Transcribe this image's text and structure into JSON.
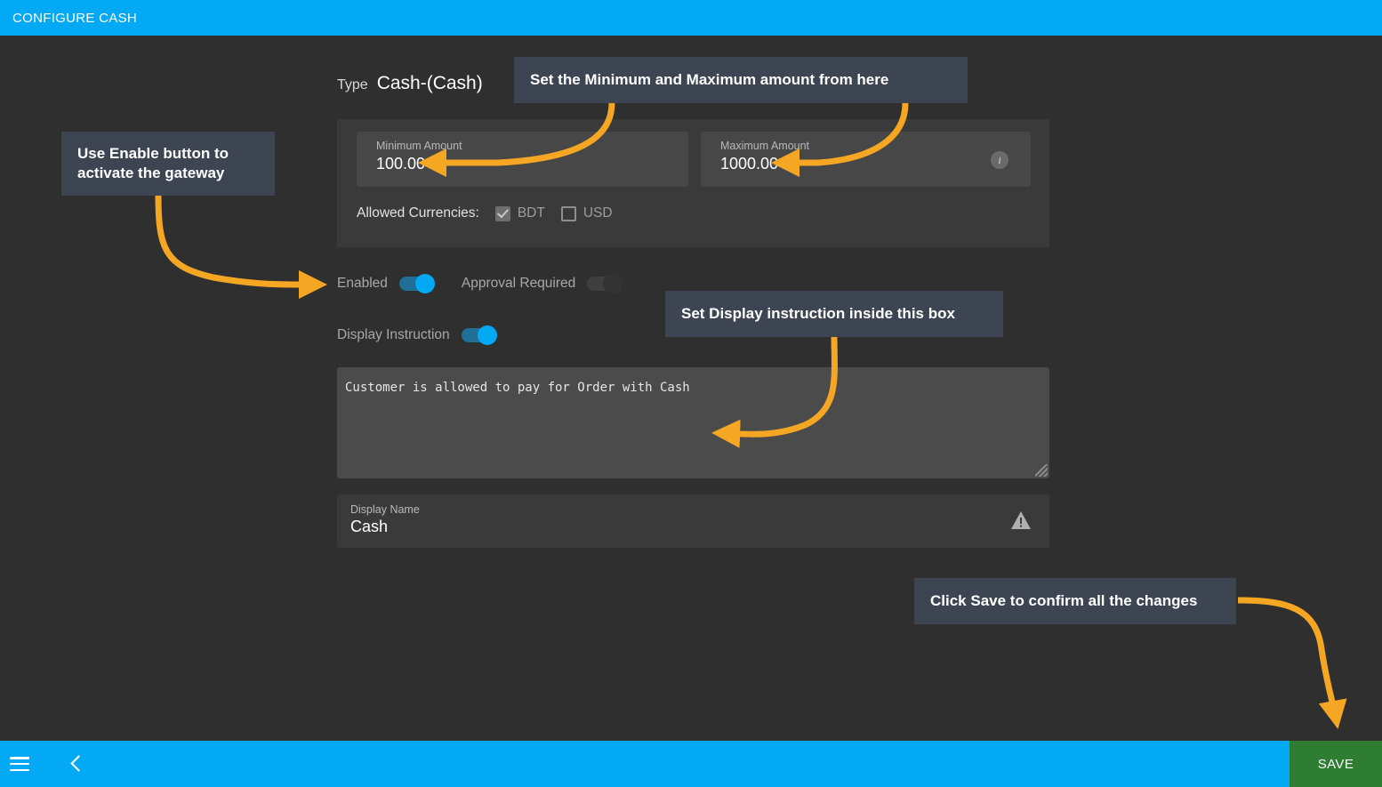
{
  "titlebar": {
    "title": "CONFIGURE CASH"
  },
  "type_row": {
    "label": "Type",
    "value": "Cash-(Cash)"
  },
  "amount_panel": {
    "minimum": {
      "label": "Minimum Amount",
      "value": "100.00"
    },
    "maximum": {
      "label": "Maximum Amount",
      "value": "1000.00"
    },
    "info_icon": "i",
    "currencies": {
      "label": "Allowed Currencies:",
      "options": [
        {
          "code": "BDT",
          "checked": true
        },
        {
          "code": "USD",
          "checked": false
        }
      ]
    }
  },
  "toggles": {
    "enabled": {
      "label": "Enabled",
      "state": "on"
    },
    "approval_required": {
      "label": "Approval Required",
      "state": "off"
    },
    "display_instruction": {
      "label": "Display Instruction",
      "state": "on"
    }
  },
  "instruction": {
    "text": "Customer is allowed to pay for Order with Cash"
  },
  "display_name": {
    "label": "Display Name",
    "value": "Cash"
  },
  "bottombar": {
    "save_label": "SAVE"
  },
  "callouts": {
    "minmax": "Set the Minimum and Maximum amount from here",
    "enable_line1": "Use Enable button to",
    "enable_line2": "activate the gateway",
    "instruction": "Set Display instruction inside this box",
    "save": "Click Save to confirm all the changes"
  },
  "colors": {
    "accent_blue": "#03a9f4",
    "save_green": "#2e7d32",
    "annotation_orange": "#f5a623",
    "callout_bg": "#3d4452",
    "page_bg": "#2f2f2f",
    "panel_bg": "#3a3a3a",
    "field_bg": "#474747",
    "textarea_bg": "#4b4b4b"
  }
}
